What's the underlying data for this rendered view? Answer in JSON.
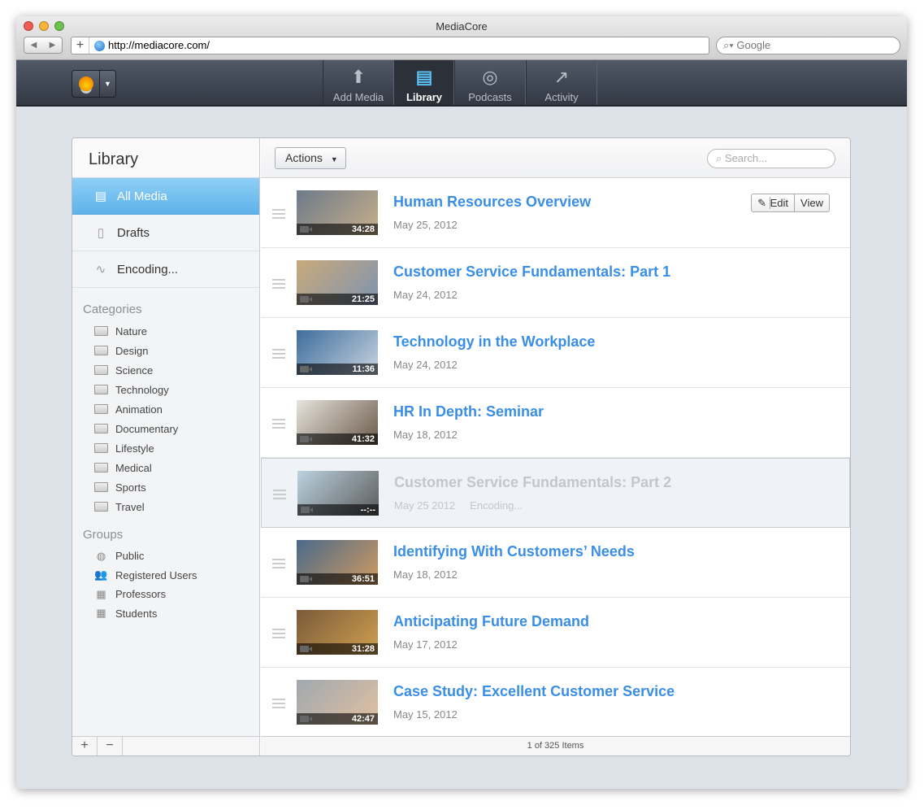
{
  "window": {
    "title": "MediaCore",
    "url": "http://mediacore.com/",
    "search_placeholder": "Google"
  },
  "appbar": {
    "tabs": [
      {
        "label": "Add Media",
        "icon": "upload-icon"
      },
      {
        "label": "Library",
        "icon": "library-icon"
      },
      {
        "label": "Podcasts",
        "icon": "podcast-icon"
      },
      {
        "label": "Activity",
        "icon": "activity-icon"
      }
    ]
  },
  "sidebar": {
    "title": "Library",
    "items": [
      {
        "label": "All Media"
      },
      {
        "label": "Drafts"
      },
      {
        "label": "Encoding..."
      }
    ],
    "categories_label": "Categories",
    "categories": [
      "Nature",
      "Design",
      "Science",
      "Technology",
      "Animation",
      "Documentary",
      "Lifestyle",
      "Medical",
      "Sports",
      "Travel"
    ],
    "groups_label": "Groups",
    "groups": [
      "Public",
      "Registered Users",
      "Professors",
      "Students"
    ]
  },
  "toolbar": {
    "actions_label": "Actions",
    "search_placeholder": "Search..."
  },
  "row_buttons": {
    "edit": "Edit",
    "view": "View"
  },
  "media": [
    {
      "title": "Human Resources Overview",
      "date": "May 25, 2012",
      "duration": "34:28"
    },
    {
      "title": "Customer Service Fundamentals: Part 1",
      "date": "May 24, 2012",
      "duration": "21:25"
    },
    {
      "title": "Technology in the Workplace",
      "date": "May 24, 2012",
      "duration": "11:36"
    },
    {
      "title": "HR In Depth: Seminar",
      "date": "May 18, 2012",
      "duration": "41:32"
    },
    {
      "title": "Customer Service Fundamentals: Part 2",
      "date": "May 25 2012",
      "duration": "--:--",
      "status": "Encoding..."
    },
    {
      "title": "Identifying With Customers’ Needs",
      "date": "May 18, 2012",
      "duration": "36:51"
    },
    {
      "title": "Anticipating Future Demand",
      "date": "May 17, 2012",
      "duration": "31:28"
    },
    {
      "title": "Case Study: Excellent Customer Service",
      "date": "May 15, 2012",
      "duration": "42:47"
    }
  ],
  "footer": {
    "count": "1 of 325 Items"
  }
}
